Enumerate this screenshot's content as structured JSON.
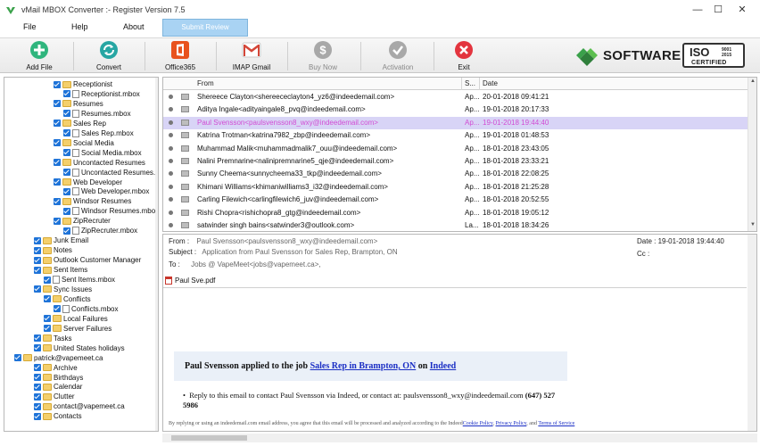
{
  "window": {
    "title": "vMail MBOX Converter :- Register Version 7.5",
    "minimize": "—",
    "maximize": "☐",
    "close": "✕"
  },
  "menu": {
    "file": "File",
    "help": "Help",
    "about": "About",
    "submit_review": "Submit Review"
  },
  "toolbar": {
    "add_file": "Add File",
    "convert": "Convert",
    "office365": "Office365",
    "imap_gmail": "IMAP Gmail",
    "buy_now": "Buy Now",
    "activation": "Activation",
    "exit": "Exit"
  },
  "brand": {
    "word": "SOFTWARE",
    "iso_title": "ISO",
    "iso_number": "9001\n2015",
    "iso_certified": "CERTIFIED"
  },
  "tree": {
    "items": [
      {
        "label": "Receptionist",
        "type": "folder",
        "indent": 5
      },
      {
        "label": "Receptionist.mbox",
        "type": "file",
        "indent": 6
      },
      {
        "label": "Resumes",
        "type": "folder",
        "indent": 5
      },
      {
        "label": "Resumes.mbox",
        "type": "file",
        "indent": 6
      },
      {
        "label": "Sales Rep",
        "type": "folder",
        "indent": 5
      },
      {
        "label": "Sales Rep.mbox",
        "type": "file",
        "indent": 6
      },
      {
        "label": "Social Media",
        "type": "folder",
        "indent": 5
      },
      {
        "label": "Social Media.mbox",
        "type": "file",
        "indent": 6
      },
      {
        "label": "Uncontacted Resumes",
        "type": "folder",
        "indent": 5
      },
      {
        "label": "Uncontacted Resumes.mbox",
        "type": "file",
        "indent": 6
      },
      {
        "label": "Web Developer",
        "type": "folder",
        "indent": 5
      },
      {
        "label": "Web Developer.mbox",
        "type": "file",
        "indent": 6
      },
      {
        "label": "Windsor Resumes",
        "type": "folder",
        "indent": 5
      },
      {
        "label": "Windsor Resumes.mbox",
        "type": "file",
        "indent": 6
      },
      {
        "label": "ZipRecruter",
        "type": "folder",
        "indent": 5
      },
      {
        "label": "ZipRecruter.mbox",
        "type": "file",
        "indent": 6
      },
      {
        "label": "Junk Email",
        "type": "folder",
        "indent": 3
      },
      {
        "label": "Notes",
        "type": "folder",
        "indent": 3
      },
      {
        "label": "Outlook Customer Manager",
        "type": "folder",
        "indent": 3
      },
      {
        "label": "Sent Items",
        "type": "folder",
        "indent": 3
      },
      {
        "label": "Sent Items.mbox",
        "type": "file",
        "indent": 4
      },
      {
        "label": "Sync Issues",
        "type": "folder",
        "indent": 3
      },
      {
        "label": "Conflicts",
        "type": "folder",
        "indent": 4
      },
      {
        "label": "Conflicts.mbox",
        "type": "file",
        "indent": 5
      },
      {
        "label": "Local Failures",
        "type": "folder",
        "indent": 4
      },
      {
        "label": "Server Failures",
        "type": "folder",
        "indent": 4
      },
      {
        "label": "Tasks",
        "type": "folder",
        "indent": 3
      },
      {
        "label": "United States holidays",
        "type": "folder",
        "indent": 3
      },
      {
        "label": "patrick@vapemeet.ca",
        "type": "folder",
        "indent": 1
      },
      {
        "label": "Archive",
        "type": "folder",
        "indent": 3
      },
      {
        "label": "Birthdays",
        "type": "folder",
        "indent": 3
      },
      {
        "label": "Calendar",
        "type": "folder",
        "indent": 3
      },
      {
        "label": "Clutter",
        "type": "folder",
        "indent": 3
      },
      {
        "label": "contact@vapemeet.ca",
        "type": "folder",
        "indent": 3
      },
      {
        "label": "Contacts",
        "type": "folder",
        "indent": 3
      }
    ]
  },
  "list": {
    "headers": {
      "from": "From",
      "subject": "S...",
      "date": "Date"
    },
    "rows": [
      {
        "from": "Shereece Clayton<shereececlayton4_yz6@indeedemail.com>",
        "subject": "Ap...",
        "date": "20-01-2018 09:41:21",
        "selected": false
      },
      {
        "from": "Aditya Ingale<adityaingale8_pvq@indeedemail.com>",
        "subject": "Ap...",
        "date": "19-01-2018 20:17:33",
        "selected": false
      },
      {
        "from": "Paul Svensson<paulsvensson8_wxy@indeedemail.com>",
        "subject": "Ap...",
        "date": "19-01-2018 19:44:40",
        "selected": true
      },
      {
        "from": "Katrina Trotman<katrina7982_zbp@indeedemail.com>",
        "subject": "Ap...",
        "date": "19-01-2018 01:48:53",
        "selected": false
      },
      {
        "from": "Muhammad Malik<muhammadmalik7_ouu@indeedemail.com>",
        "subject": "Ap...",
        "date": "18-01-2018 23:43:05",
        "selected": false
      },
      {
        "from": "Nalini Premnarine<nalinipremnarine5_qje@indeedemail.com>",
        "subject": "Ap...",
        "date": "18-01-2018 23:33:21",
        "selected": false
      },
      {
        "from": "Sunny Cheema<sunnycheema33_tkp@indeedemail.com>",
        "subject": "Ap...",
        "date": "18-01-2018 22:08:25",
        "selected": false
      },
      {
        "from": "Khimani Williams<khimaniwilliams3_i32@indeedemail.com>",
        "subject": "Ap...",
        "date": "18-01-2018 21:25:28",
        "selected": false
      },
      {
        "from": "Carling Filewich<carlingfilewich6_juv@indeedemail.com>",
        "subject": "Ap...",
        "date": "18-01-2018 20:52:55",
        "selected": false
      },
      {
        "from": "Rishi Chopra<rishichopra8_gtg@indeedemail.com>",
        "subject": "Ap...",
        "date": "18-01-2018 19:05:12",
        "selected": false
      },
      {
        "from": "satwinder singh bains<satwinder3@outlook.com>",
        "subject": "La...",
        "date": "18-01-2018 18:34:26",
        "selected": false
      }
    ]
  },
  "preview": {
    "from_label": "From :",
    "from_value": "Paul Svensson<paulsvensson8_wxy@indeedemail.com>",
    "subject_label": "Subject :",
    "subject_value": "Application from Paul Svensson for Sales Rep, Brampton, ON",
    "to_label": "To :",
    "to_value": "Jobs @ VapeMeet<jobs@vapemeet.ca>,",
    "date_label": "Date :",
    "date_value": "19-01-2018 19:44:40",
    "cc_label": "Cc :",
    "attachment": "Paul Sve.pdf",
    "banner_prefix": "Paul Svensson applied to the job ",
    "banner_job": "Sales Rep in Brampton, ON",
    "banner_on": " on ",
    "banner_site": "Indeed",
    "bullet_text": "Reply to this email to contact Paul Svensson via Indeed, or contact at: paulsvensson8_wxy@indeedemail.com",
    "bullet_phone": "(647) 527 5986",
    "footer_text": "By replying or using an indeedemail.com email address, you agree that this email will be processed and analyzed according to the Indeed",
    "footer_cookie": "Cookie Policy",
    "footer_privacy": "Privacy Policy",
    "footer_and": ", and",
    "footer_terms": "Terms of Service"
  }
}
